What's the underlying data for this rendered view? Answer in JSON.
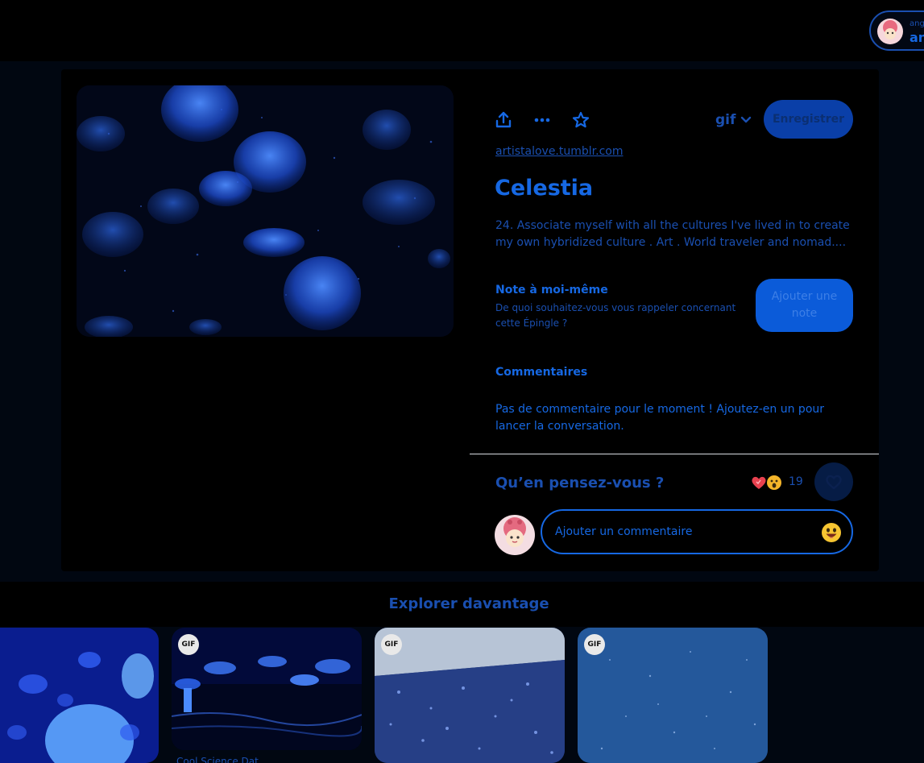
{
  "header": {
    "user_small": "ang",
    "user_big": "an"
  },
  "pin": {
    "actions": {
      "share_icon": "share-upload-icon",
      "more_icon": "ellipsis-icon",
      "favorite_icon": "star-icon"
    },
    "board_select": "gif",
    "save_label": "Enregistrer",
    "source": "artistalove.tumblr.com",
    "title": "Celestia",
    "description": "24. Associate myself with all the cultures I've lived in to create my own hybridized culture . Art . World traveler and nomad....",
    "note": {
      "title": "Note à moi-même",
      "subtitle": "De quoi souhaitez-vous vous rappeler concernant cette Épingle ?",
      "button": "Ajouter une note"
    },
    "comments": {
      "title": "Commentaires",
      "empty": "Pas de commentaire pour le moment ! Ajoutez-en un pour lancer la conversation."
    },
    "feedback": {
      "question": "Qu’en pensez-vous ?",
      "reactions": [
        "heart-emoji",
        "surprised-emoji"
      ],
      "count": "19"
    },
    "comment_input": {
      "placeholder": "Ajouter un commentaire"
    }
  },
  "explore": {
    "title": "Explorer davantage",
    "tiles": [
      {
        "gif": false
      },
      {
        "gif": true,
        "badge": "GIF",
        "caption": "Cool Science Dat..."
      },
      {
        "gif": true,
        "badge": "GIF"
      },
      {
        "gif": true,
        "badge": "GIF"
      }
    ]
  },
  "colors": {
    "accent": "#1668e3",
    "accent_dark": "#1a4fb0",
    "background": "#000000"
  }
}
